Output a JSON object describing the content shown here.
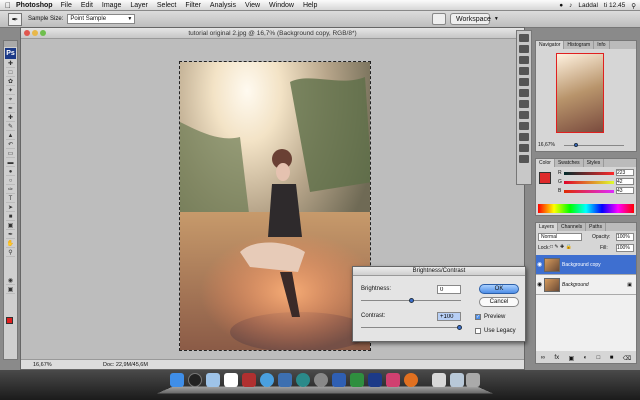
{
  "menubar": {
    "app_name": "Photoshop",
    "menus": [
      "File",
      "Edit",
      "Image",
      "Layer",
      "Select",
      "Filter",
      "Analysis",
      "View",
      "Window",
      "Help"
    ],
    "user": "Laddal",
    "clock": "ti 12.45"
  },
  "options": {
    "sample_size_label": "Sample Size:",
    "sample_size_value": "Point Sample",
    "workspace_label": "Workspace"
  },
  "document": {
    "title": "tutorial original 2.jpg @ 16,7% (Background copy, RGB/8*)",
    "zoom": "16,67%",
    "doc_size": "Doc: 22,9M/45,6M"
  },
  "dialog": {
    "title": "Brightness/Contrast",
    "brightness_label": "Brightness:",
    "brightness_value": "0",
    "contrast_label": "Contrast:",
    "contrast_value": "+100",
    "ok_label": "OK",
    "cancel_label": "Cancel",
    "preview_label": "Preview",
    "legacy_label": "Use Legacy"
  },
  "navigator": {
    "tabs": [
      "Navigator",
      "Histogram",
      "Info"
    ],
    "zoom": "16,67%"
  },
  "color": {
    "tabs": [
      "Color",
      "Swatches",
      "Styles"
    ],
    "channels": [
      {
        "name": "R",
        "value": "223"
      },
      {
        "name": "G",
        "value": "42"
      },
      {
        "name": "B",
        "value": "43"
      }
    ],
    "foreground": "#df2a2b"
  },
  "layers": {
    "tabs": [
      "Layers",
      "Channels",
      "Paths"
    ],
    "blend_mode": "Normal",
    "opacity_label": "Opacity:",
    "opacity_value": "100%",
    "lock_label": "Lock:",
    "fill_label": "Fill:",
    "fill_value": "100%",
    "items": [
      {
        "name": "Background copy",
        "selected": true
      },
      {
        "name": "Background",
        "selected": false
      }
    ]
  }
}
